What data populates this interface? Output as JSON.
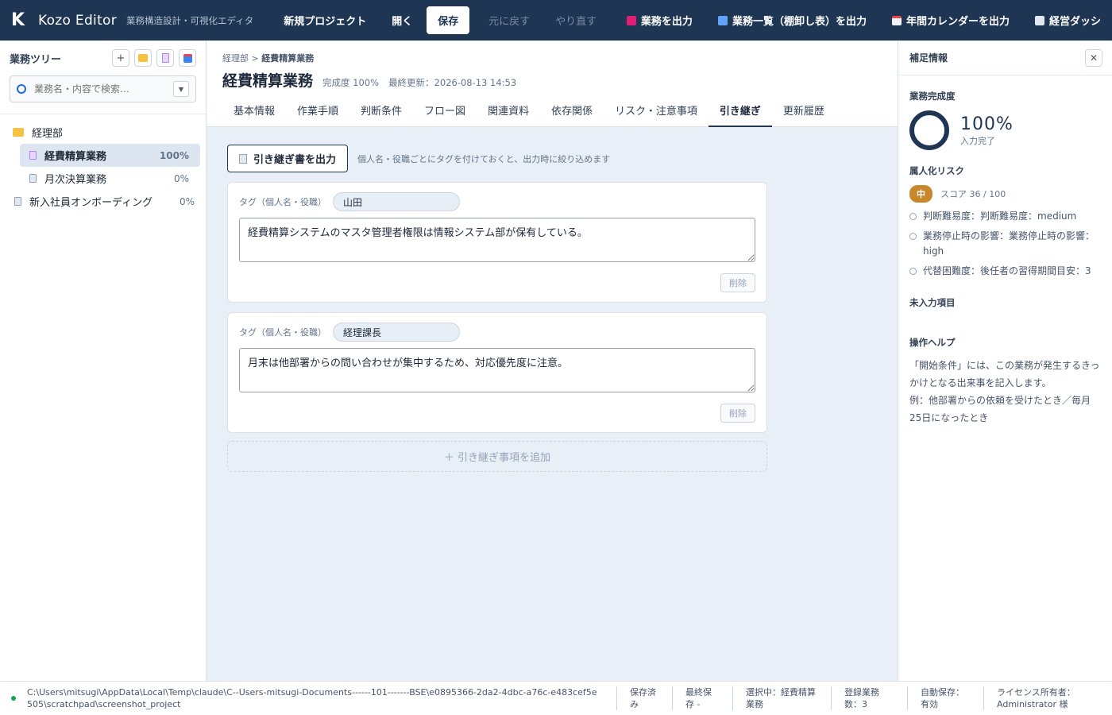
{
  "app": {
    "name": "Kozo Editor",
    "subtitle": "業務構造設計・可視化エディタ"
  },
  "toolbar": {
    "new_project": "新規プロジェクト",
    "open": "開く",
    "save": "保存",
    "undo": "元に戻す",
    "redo": "やり直す",
    "export_task": "業務を出力",
    "export_list": "業務一覧（棚卸し表）を出力",
    "export_calendar": "年間カレンダーを出力",
    "dashboard": "経営ダッシ"
  },
  "sidebar": {
    "title": "業務ツリー",
    "search_placeholder": "業務名・内容で検索…",
    "tree": [
      {
        "label": "経理部"
      },
      {
        "label": "経費精算業務",
        "pct": "100%"
      },
      {
        "label": "月次決算業務",
        "pct": "0%"
      },
      {
        "label": "新入社員オンボーディング",
        "pct": "0%"
      }
    ]
  },
  "main": {
    "breadcrumb_parent": "経理部",
    "breadcrumb_sep": " > ",
    "breadcrumb_current": "経費精算業務",
    "title": "経費精算業務",
    "completion": "完成度 100%",
    "last_update": "最終更新：2026-08-13 14:53",
    "tabs": [
      "基本情報",
      "作業手順",
      "判断条件",
      "フロー図",
      "関連資料",
      "依存関係",
      "リスク・注意事項",
      "引き継ぎ",
      "更新履歴"
    ],
    "export_label": "引き継ぎ書を出力",
    "export_hint": "個人名・役職ごとにタグを付けておくと、出力時に絞り込めます",
    "tag_label": "タグ（個人名・役職）",
    "delete_label": "削除",
    "cards": [
      {
        "tag": "山田",
        "note": "経費精算システムのマスタ管理者権限は情報システム部が保有している。"
      },
      {
        "tag": "経理課長",
        "note": "月末は他部署からの問い合わせが集中するため、対応優先度に注意。"
      }
    ],
    "add_label": "＋ 引き継ぎ事項を追加"
  },
  "right": {
    "title": "補足情報",
    "completion_title": "業務完成度",
    "completion_pct": "100%",
    "completion_sub": "入力完了",
    "risk_title": "属人化リスク",
    "risk_level": "中",
    "risk_score": "スコア 36 / 100",
    "risk_items": [
      "判断難易度：判断難易度：medium",
      "業務停止時の影響：業務停止時の影響：high",
      "代替困難度：後任者の習得期間目安：3"
    ],
    "missing_title": "未入力項目",
    "help_title": "操作ヘルプ",
    "help_text": "「開始条件」には、この業務が発生するきっかけとなる出来事を記入します。",
    "help_example": "例：他部署からの依頼を受けたとき／毎月25日になったとき"
  },
  "status": {
    "path": "C:\\Users\\mitsugi\\AppData\\Local\\Temp\\claude\\C--Users-mitsugi-Documents------101-------BSE\\e0895366-2da2-4dbc-a76c-e483cef5e505\\scratchpad\\screenshot_project",
    "saved": "保存済み",
    "last_saved": "最終保存 -",
    "selected": "選択中：経費精算業務",
    "count": "登録業務数：3",
    "autosave": "自動保存：有効",
    "license": "ライセンス所有者：Administrator 様"
  },
  "colors": {
    "header_bg": "#1e3553",
    "risk_medium": "#c9872b",
    "status_ok": "#16a34a"
  }
}
